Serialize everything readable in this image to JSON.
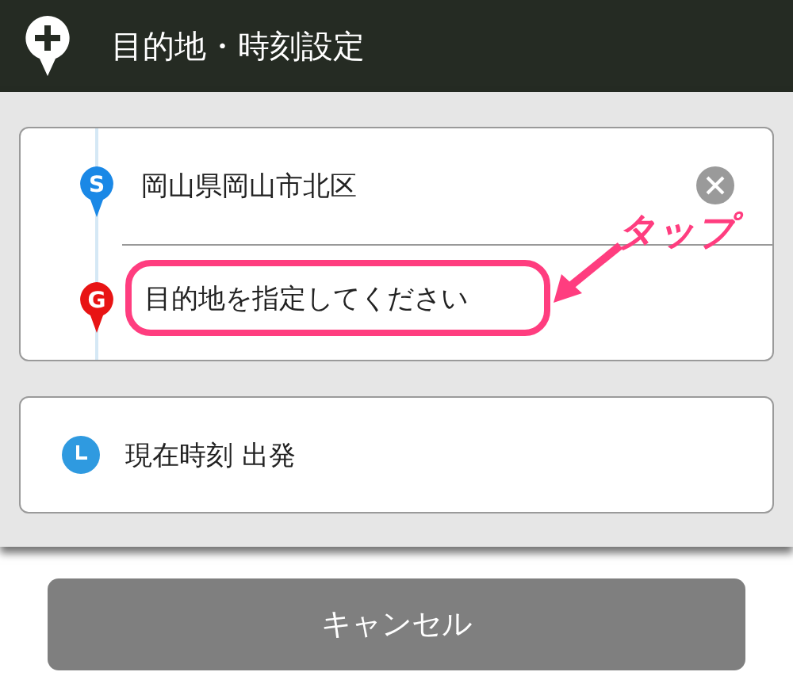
{
  "header": {
    "title": "目的地・時刻設定"
  },
  "route": [
    {
      "kind": "start",
      "pin": "S",
      "color": "#1a88e6",
      "value": "岡山県岡山市北区"
    },
    {
      "kind": "goal",
      "pin": "G",
      "color": "#e81414",
      "placeholder": "目的地を指定してください"
    }
  ],
  "time": {
    "label": "現在時刻 出発"
  },
  "annotation": {
    "label": "タップ"
  },
  "buttons": [
    {
      "label": "キャンセル"
    }
  ]
}
